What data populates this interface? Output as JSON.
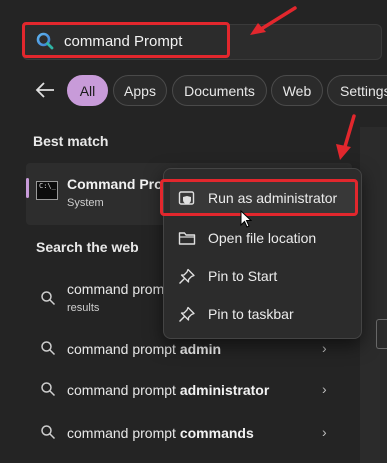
{
  "search": {
    "value": "command Prompt"
  },
  "tabs": [
    "All",
    "Apps",
    "Documents",
    "Web",
    "Settings"
  ],
  "best_match": {
    "section": "Best match",
    "title": "Command Prompt",
    "subtitle": "System",
    "icon_text": "C:\\_"
  },
  "web": {
    "section": "Search the web",
    "results": [
      {
        "prefix": "command prompt",
        "bold": "",
        "sub": "results"
      },
      {
        "prefix": "command prompt ",
        "bold": "admin",
        "sub": ""
      },
      {
        "prefix": "command prompt ",
        "bold": "administrator",
        "sub": ""
      },
      {
        "prefix": "command prompt ",
        "bold": "commands",
        "sub": ""
      }
    ]
  },
  "context_menu": {
    "items": [
      {
        "label": "Run as administrator",
        "icon": "shield-icon"
      },
      {
        "label": "Open file location",
        "icon": "folder-icon"
      },
      {
        "label": "Pin to Start",
        "icon": "pin-icon"
      },
      {
        "label": "Pin to taskbar",
        "icon": "pin-icon"
      }
    ]
  },
  "colors": {
    "accent": "#c89bd9",
    "annotation": "#e2272d",
    "background": "#242424"
  }
}
